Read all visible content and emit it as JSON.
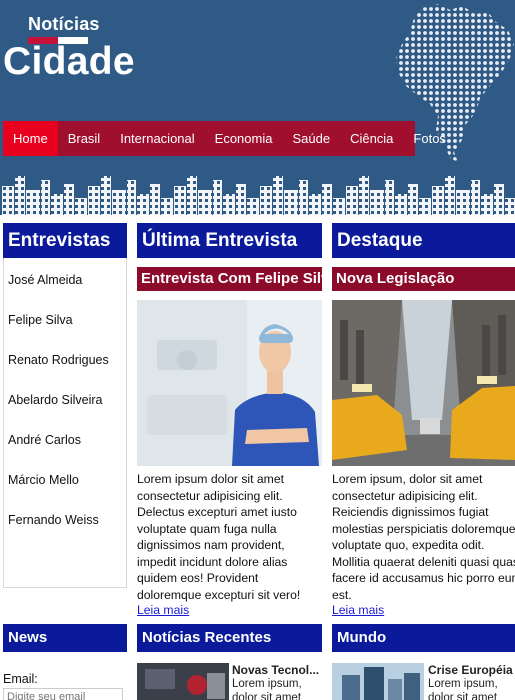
{
  "header": {
    "logo_top": "Notícias",
    "logo_main": "Cidade"
  },
  "nav": {
    "items": [
      {
        "label": "Home",
        "active": true
      },
      {
        "label": "Brasil"
      },
      {
        "label": "Internacional"
      },
      {
        "label": "Economia"
      },
      {
        "label": "Saúde"
      },
      {
        "label": "Ciência"
      },
      {
        "label": "Fotos"
      }
    ]
  },
  "interviews": {
    "title": "Entrevistas",
    "items": [
      "José Almeida",
      "Felipe Silva",
      "Renato Rodrigues",
      "Abelardo Silveira",
      "André Carlos",
      "Márcio Mello",
      "Fernando Weiss"
    ]
  },
  "latest_interview": {
    "title": "Última Entrevista",
    "subtitle": "Entrevista Com Felipe Silva",
    "text": "Lorem ipsum dolor sit amet consectetur adipisicing elit. Delectus excepturi amet iusto voluptate quam fuga nulla dignissimos nam provident, impedit incidunt dolore alias quidem eos! Provident doloremque excepturi sit vero!",
    "link": "Leia mais"
  },
  "highlight": {
    "title": "Destaque",
    "subtitle": "Nova Legislação",
    "text": "Lorem ipsum, dolor sit amet consectetur adipisicing elit. Reiciendis dignissimos fugiat molestias perspiciatis doloremque voluptate quo, expedita odit. Mollitia quaerat deleniti quasi quas facere id accusamus hic porro eum est.",
    "link": "Leia mais"
  },
  "news": {
    "title": "News",
    "email_label": "Email:",
    "email_placeholder": "Digite seu email"
  },
  "recent": {
    "title": "Notícias Recentes",
    "item_title": "Novas Tecnol...",
    "item_text": "Lorem ipsum, dolor sit amet"
  },
  "world": {
    "title": "Mundo",
    "item_title": "Crise Européia",
    "item_text": "Lorem ipsum, dolor sit amet"
  },
  "colors": {
    "header_bg": "#2f5a85",
    "nav_bg": "#a0102e",
    "nav_active": "#e8001f",
    "section_title_bg": "#0a1a9a",
    "subtitle_bg": "#8c0b2a"
  }
}
